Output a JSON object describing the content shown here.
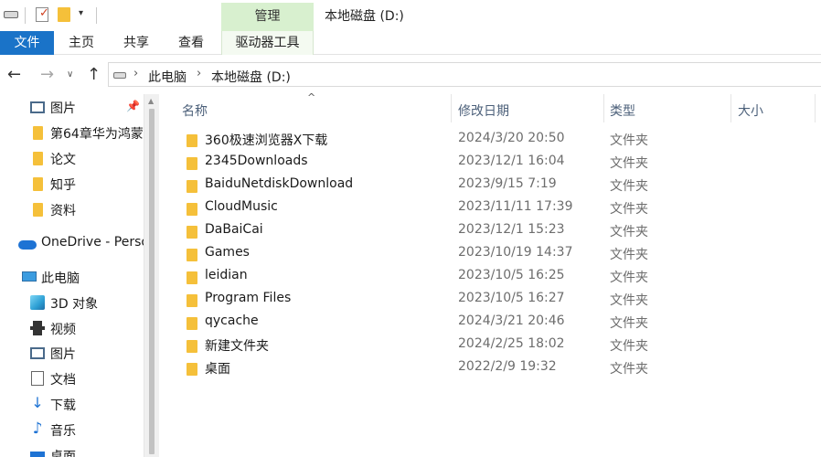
{
  "window": {
    "title": "本地磁盘 (D:)",
    "manage_tab": "管理"
  },
  "quick_access_toolbar": {
    "icons": [
      "drive-icon",
      "properties-icon",
      "new-folder-icon",
      "dropdown-icon"
    ],
    "dropdown_glyph": "▾"
  },
  "ribbon": {
    "tabs": [
      "文件",
      "主页",
      "共享",
      "查看",
      "驱动器工具"
    ],
    "active_tab_color": "#1a73c8",
    "context_tab_color": "#d8f0cf"
  },
  "address_bar": {
    "back_glyph": "←",
    "forward_glyph": "→",
    "recent_glyph": "∨",
    "up_glyph": "↑",
    "separator_glyph": "›",
    "breadcrumbs": [
      "此电脑",
      "本地磁盘 (D:)"
    ]
  },
  "navigation_pane": {
    "pin_glyph": "📌",
    "items": [
      {
        "label": "图片",
        "icon": "pictures-icon"
      },
      {
        "label": "第64章华为鸿蒙",
        "icon": "folder-icon"
      },
      {
        "label": "论文",
        "icon": "folder-icon"
      },
      {
        "label": "知乎",
        "icon": "folder-icon"
      },
      {
        "label": "资料",
        "icon": "folder-icon"
      },
      {
        "label": "OneDrive - Perso",
        "icon": "onedrive-icon"
      },
      {
        "label": "此电脑",
        "icon": "pc-icon"
      },
      {
        "label": "3D 对象",
        "icon": "3d-objects-icon"
      },
      {
        "label": "视频",
        "icon": "videos-icon"
      },
      {
        "label": "图片",
        "icon": "pictures-icon"
      },
      {
        "label": "文档",
        "icon": "documents-icon"
      },
      {
        "label": "下载",
        "icon": "downloads-icon"
      },
      {
        "label": "音乐",
        "icon": "music-icon"
      },
      {
        "label": "桌面",
        "icon": "desktop-icon"
      }
    ]
  },
  "file_list": {
    "sort_glyph": "^",
    "columns": [
      "名称",
      "修改日期",
      "类型",
      "大小"
    ],
    "rows": [
      {
        "name": "360极速浏览器X下载",
        "date": "2024/3/20 20:50",
        "type": "文件夹"
      },
      {
        "name": "2345Downloads",
        "date": "2023/12/1 16:04",
        "type": "文件夹"
      },
      {
        "name": "BaiduNetdiskDownload",
        "date": "2023/9/15 7:19",
        "type": "文件夹"
      },
      {
        "name": "CloudMusic",
        "date": "2023/11/11 17:39",
        "type": "文件夹"
      },
      {
        "name": "DaBaiCai",
        "date": "2023/12/1 15:23",
        "type": "文件夹"
      },
      {
        "name": "Games",
        "date": "2023/10/19 14:37",
        "type": "文件夹"
      },
      {
        "name": "leidian",
        "date": "2023/10/5 16:25",
        "type": "文件夹"
      },
      {
        "name": "Program Files",
        "date": "2023/10/5 16:27",
        "type": "文件夹"
      },
      {
        "name": "qycache",
        "date": "2024/3/21 20:46",
        "type": "文件夹"
      },
      {
        "name": "新建文件夹",
        "date": "2024/2/25 18:02",
        "type": "文件夹"
      },
      {
        "name": "桌面",
        "date": "2022/2/9 19:32",
        "type": "文件夹"
      }
    ]
  }
}
